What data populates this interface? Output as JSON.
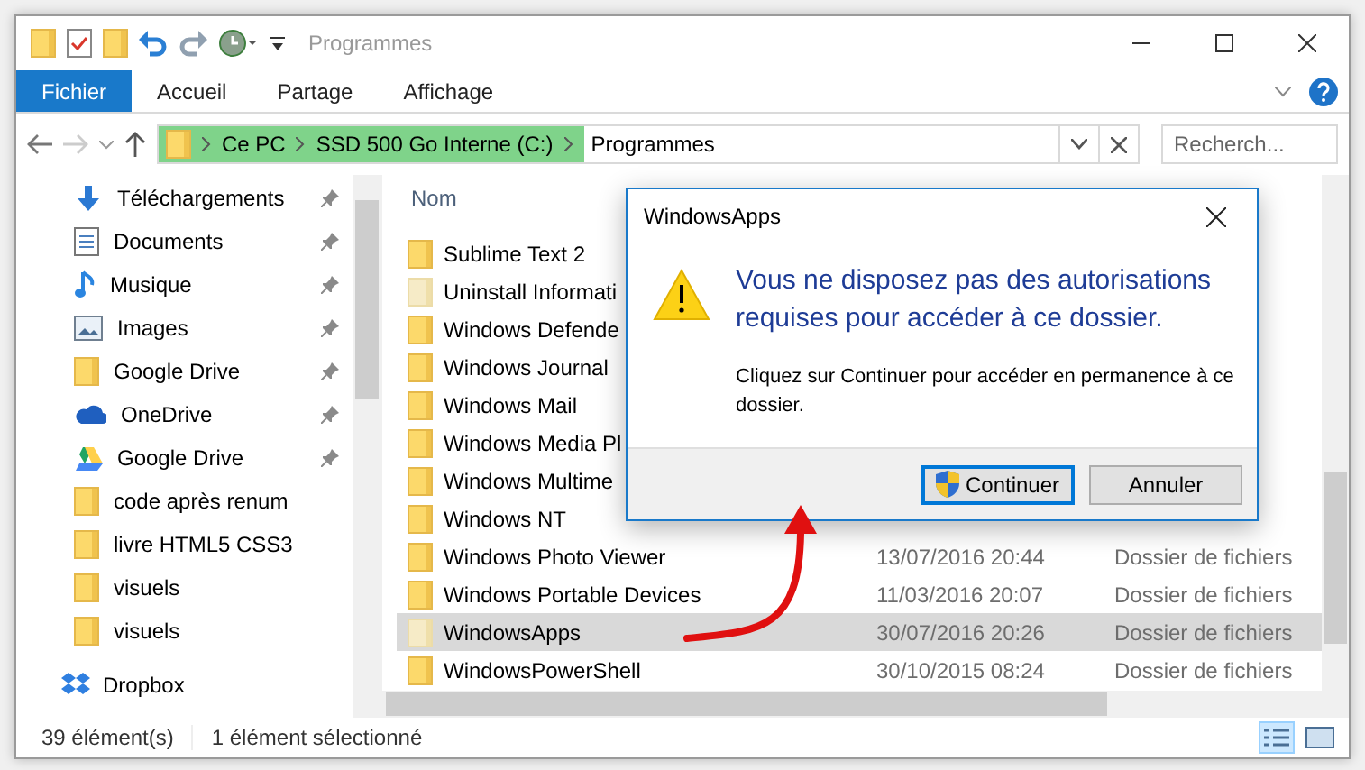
{
  "window": {
    "title": "Programmes"
  },
  "ribbon_tabs": [
    {
      "label": "Fichier",
      "selected": true
    },
    {
      "label": "Accueil",
      "selected": false
    },
    {
      "label": "Partage",
      "selected": false
    },
    {
      "label": "Affichage",
      "selected": false
    }
  ],
  "address": {
    "segments": [
      "Ce PC",
      "SSD 500 Go Interne (C:)"
    ],
    "current": "Programmes"
  },
  "search": {
    "placeholder": "Recherch..."
  },
  "sidebar": {
    "items": [
      {
        "label": "Téléchargements",
        "kind": "download",
        "pinned": true
      },
      {
        "label": "Documents",
        "kind": "document",
        "pinned": true
      },
      {
        "label": "Musique",
        "kind": "music",
        "pinned": true
      },
      {
        "label": "Images",
        "kind": "image",
        "pinned": true
      },
      {
        "label": "Google Drive",
        "kind": "folder",
        "pinned": true
      },
      {
        "label": "OneDrive",
        "kind": "cloud",
        "pinned": true
      },
      {
        "label": "Google Drive",
        "kind": "drive",
        "pinned": true
      },
      {
        "label": "code après renum",
        "kind": "folder",
        "pinned": false
      },
      {
        "label": "livre HTML5 CSS3",
        "kind": "folder",
        "pinned": false
      },
      {
        "label": "visuels",
        "kind": "folder",
        "pinned": false
      },
      {
        "label": "visuels",
        "kind": "folder",
        "pinned": false
      }
    ],
    "footer_item": {
      "label": "Dropbox",
      "kind": "dropbox"
    }
  },
  "columns": [
    "Nom"
  ],
  "files": [
    {
      "name": "Sublime Text 2",
      "hidden": false,
      "selected": false
    },
    {
      "name": "Uninstall Informati",
      "hidden": true,
      "selected": false
    },
    {
      "name": "Windows Defende",
      "hidden": false,
      "selected": false
    },
    {
      "name": "Windows Journal",
      "hidden": false,
      "selected": false
    },
    {
      "name": "Windows Mail",
      "hidden": false,
      "selected": false
    },
    {
      "name": "Windows Media Pl",
      "hidden": false,
      "selected": false
    },
    {
      "name": "Windows Multime",
      "hidden": false,
      "selected": false
    },
    {
      "name": "Windows NT",
      "hidden": false,
      "selected": false
    },
    {
      "name": "Windows Photo Viewer",
      "date": "13/07/2016 20:44",
      "type": "Dossier de fichiers",
      "hidden": false,
      "selected": false
    },
    {
      "name": "Windows Portable Devices",
      "date": "11/03/2016 20:07",
      "type": "Dossier de fichiers",
      "hidden": false,
      "selected": false
    },
    {
      "name": "WindowsApps",
      "date": "30/07/2016 20:26",
      "type": "Dossier de fichiers",
      "hidden": true,
      "selected": true
    },
    {
      "name": "WindowsPowerShell",
      "date": "30/10/2015 08:24",
      "type": "Dossier de fichiers",
      "hidden": false,
      "selected": false
    }
  ],
  "dialog": {
    "title": "WindowsApps",
    "heading": "Vous ne disposez pas des autorisations requises pour accéder à ce dossier.",
    "message": "Cliquez sur Continuer pour accéder en permanence à ce dossier.",
    "buttons": [
      {
        "label": "Continuer",
        "primary": true,
        "shield": true
      },
      {
        "label": "Annuler",
        "primary": false,
        "shield": false
      }
    ]
  },
  "status_bar": {
    "count": "39 élément(s)",
    "selection": "1 élément sélectionné"
  }
}
